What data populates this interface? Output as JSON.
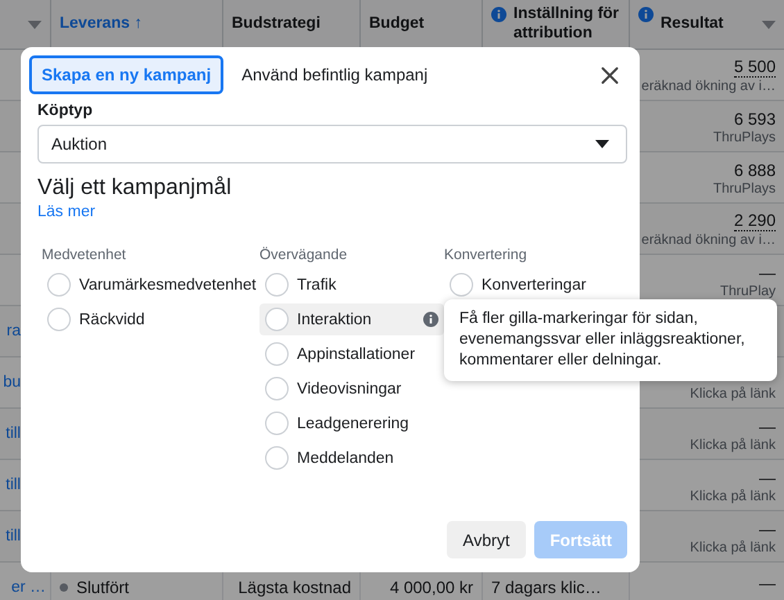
{
  "table": {
    "columns": [
      {
        "label": "Leverans",
        "sorted": true,
        "sort_arrow": "↑",
        "info": false,
        "menu": false
      },
      {
        "label": "Budstrategi",
        "sorted": false,
        "info": false,
        "menu": false
      },
      {
        "label": "Budget",
        "sorted": false,
        "info": false,
        "menu": false
      },
      {
        "label": "Inställning för attribution",
        "sorted": false,
        "info": true,
        "menu": false
      },
      {
        "label": "Resultat",
        "sorted": false,
        "info": true,
        "menu": true
      }
    ],
    "rows": [
      {
        "result": "5 500",
        "estimated": true,
        "result_label": "eräknad ökning av i…"
      },
      {
        "result": "6 593",
        "estimated": false,
        "result_label": "ThruPlays"
      },
      {
        "result": "6 888",
        "estimated": false,
        "result_label": "ThruPlays"
      },
      {
        "result": "2 290",
        "estimated": true,
        "result_label": "eräknad ökning av i…"
      },
      {
        "result": "—",
        "estimated": false,
        "result_label": "ThruPlay"
      },
      {
        "name": "ra"
      },
      {
        "name": "bu",
        "result_label": "Klicka på länk"
      },
      {
        "name": "till",
        "result": "—",
        "estimated": false,
        "result_label": "Klicka på länk"
      },
      {
        "name": "till",
        "result": "—",
        "estimated": false,
        "result_label": "Klicka på länk"
      },
      {
        "name": "till",
        "result": "—",
        "estimated": false,
        "result_label": "Klicka på länk"
      },
      {
        "name": "er …",
        "status": "Slutfört",
        "bid_strategy": "Lägsta kostnad",
        "budget": "4 000,00 kr",
        "attribution": "7 dagars klic…",
        "result": "—",
        "estimated": false
      }
    ]
  },
  "modal": {
    "tabs": [
      {
        "label": "Skapa en ny kampanj",
        "selected": true
      },
      {
        "label": "Använd befintlig kampanj",
        "selected": false
      }
    ],
    "buy_type": {
      "label": "Köptyp",
      "value": "Auktion"
    },
    "heading": "Välj ett kampanjmål",
    "link": "Läs mer",
    "groups": [
      {
        "label": "Medvetenhet",
        "options": [
          {
            "label": "Varumärkesmedvetenhet",
            "selected": false,
            "highlighted": false
          },
          {
            "label": "Räckvidd",
            "selected": false,
            "highlighted": false
          }
        ]
      },
      {
        "label": "Övervägande",
        "options": [
          {
            "label": "Trafik",
            "selected": false,
            "highlighted": false
          },
          {
            "label": "Interaktion",
            "selected": false,
            "highlighted": true
          },
          {
            "label": "Appinstallationer",
            "selected": false,
            "highlighted": false
          },
          {
            "label": "Videovisningar",
            "selected": false,
            "highlighted": false
          },
          {
            "label": "Leadgenerering",
            "selected": false,
            "highlighted": false
          },
          {
            "label": "Meddelanden",
            "selected": false,
            "highlighted": false
          }
        ]
      },
      {
        "label": "Konvertering",
        "options": [
          {
            "label": "Konverteringar",
            "selected": false,
            "highlighted": false
          }
        ]
      }
    ],
    "tooltip": "Få fler gilla-markeringar för sidan, evenemangssvar eller inläggsreaktioner, kommentarer eller delningar.",
    "buttons": [
      {
        "label": "Avbryt",
        "kind": "secondary",
        "disabled": false
      },
      {
        "label": "Fortsätt",
        "kind": "primary",
        "disabled": true
      }
    ]
  }
}
